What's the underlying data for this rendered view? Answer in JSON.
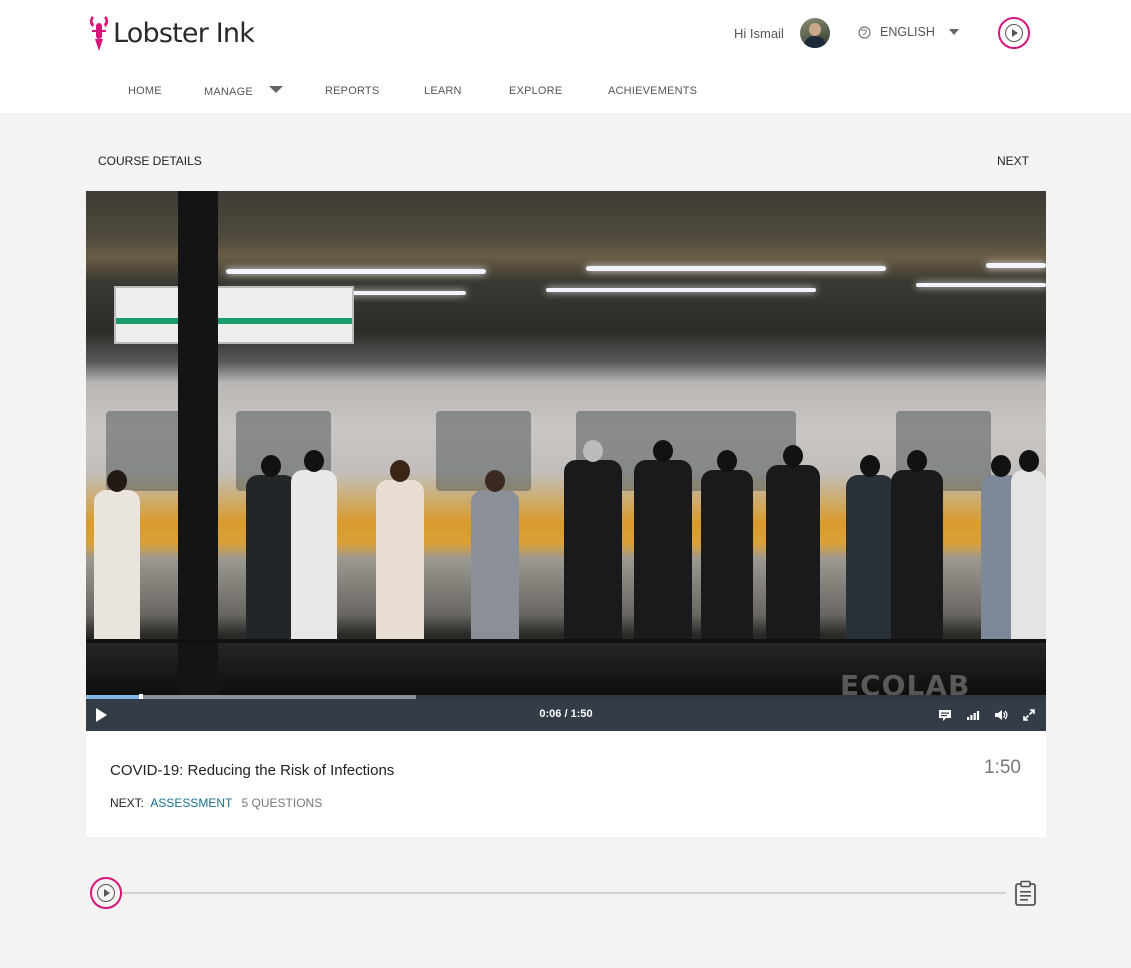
{
  "header": {
    "brand": "Lobster Ink",
    "greeting": "Hi Ismail",
    "language": "ENGLISH",
    "brand_color": "#d6157a"
  },
  "nav": {
    "items": [
      "HOME",
      "MANAGE",
      "REPORTS",
      "LEARN",
      "EXPLORE",
      "ACHIEVEMENTS"
    ]
  },
  "subbar": {
    "course_details": "COURSE DETAILS",
    "next": "NEXT"
  },
  "video": {
    "watermark": "ECOLAB",
    "timecode": "0:06 / 1:50",
    "played_fraction": 0.055,
    "buffered_fraction": 0.344
  },
  "lesson": {
    "title": "COVID-19: Reducing the Risk of Infections",
    "duration": "1:50",
    "next_label": "NEXT:",
    "next_target": "ASSESSMENT",
    "next_count": "5 QUESTIONS"
  },
  "icons": {
    "header_play": "play-circle-icon",
    "globe": "globe-icon",
    "captions": "captions-icon",
    "quality": "signal-bars-icon",
    "volume": "volume-icon",
    "fullscreen": "fullscreen-icon",
    "clipboard": "clipboard-icon"
  }
}
